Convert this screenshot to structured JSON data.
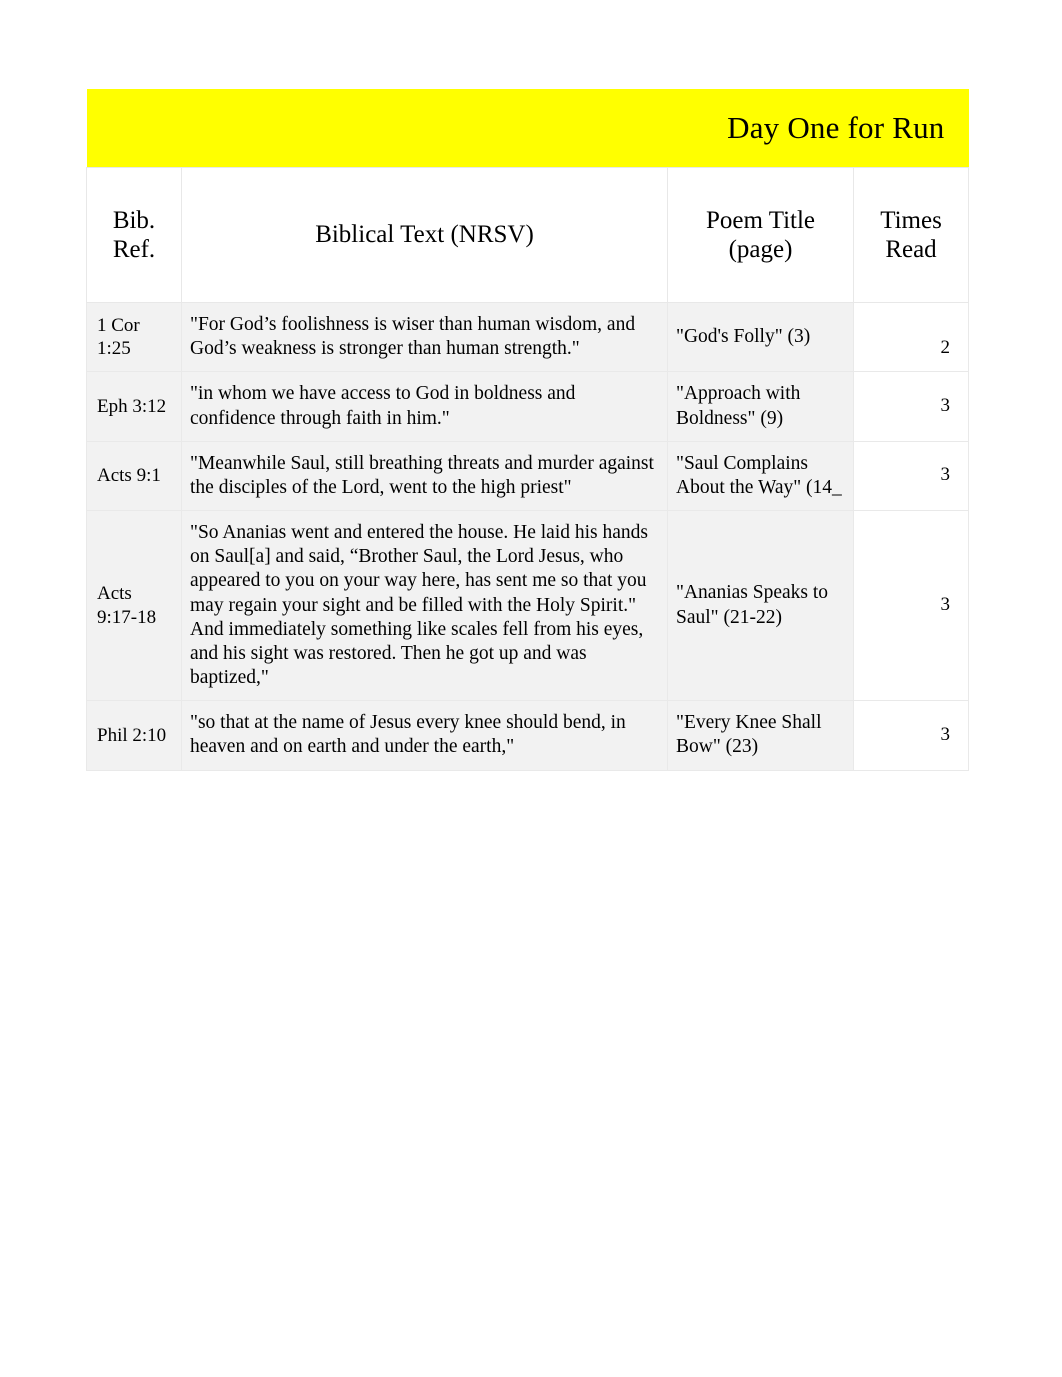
{
  "document": {
    "banner": {
      "title": "Day One for Run",
      "background_color": "#ffff00"
    },
    "table": {
      "columns": [
        {
          "id": "bib_ref",
          "label": "Bib. Ref."
        },
        {
          "id": "text",
          "label": "Biblical Text (NRSV)"
        },
        {
          "id": "poem",
          "label": "Poem Title (page)"
        },
        {
          "id": "times",
          "label": "Times Read"
        }
      ],
      "header_labels": {
        "bib_ref_line1": "Bib.",
        "bib_ref_line2": "Ref.",
        "text": "Biblical Text (NRSV)",
        "poem_line1": "Poem Title",
        "poem_line2": "(page)",
        "times_line1": "Times",
        "times_line2": "Read"
      },
      "rows": [
        {
          "bib_ref": "1 Cor 1:25",
          "text": "\"For God’s foolishness is wiser than human wisdom, and God’s weakness is stronger than human strength.\"",
          "poem": "\"God's Folly\" (3)",
          "times_read": "2"
        },
        {
          "bib_ref": "Eph 3:12",
          "text": "\"in whom we have access to God in boldness and confidence through faith in him.\"",
          "poem": "\"Approach with Boldness\" (9)",
          "times_read": "3"
        },
        {
          "bib_ref": "Acts 9:1",
          "text": "\"Meanwhile Saul, still breathing threats and murder against the disciples of the Lord, went to the high priest\"",
          "poem": "\"Saul Complains About the Way\" (14_",
          "times_read": "3"
        },
        {
          "bib_ref": "Acts 9:17-18",
          "text": "\"So Ananias went and entered the house. He laid his hands on Saul[a] and said, “Brother Saul, the Lord Jesus, who appeared to you on your way here, has sent me so that you may regain your sight and be filled with the Holy Spirit.\" And immediately something like scales fell from his eyes, and his sight was restored. Then he got up and was baptized,\"",
          "poem": "\"Ananias Speaks to Saul\" (21-22)",
          "times_read": "3"
        },
        {
          "bib_ref": "Phil 2:10",
          "text": "\"so that at the name of Jesus every knee should bend, in heaven and on earth and under the earth,\"",
          "poem": "\"Every Knee Shall Bow\" (23)",
          "times_read": "3"
        }
      ]
    }
  }
}
